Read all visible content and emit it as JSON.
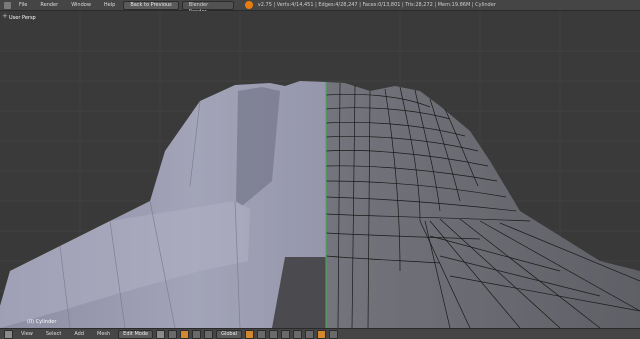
{
  "topbar": {
    "menus": [
      "File",
      "Render",
      "Window",
      "Help"
    ],
    "back_button": "Back to Previous",
    "engine": "Blender Render",
    "stats": "v2.75 | Verts:4/14,451 | Edges:4/28,247 | Faces:0/13,801 | Tris:28,272 | Mem:19.86M | Cylinder"
  },
  "viewport": {
    "view_label": "User Persp",
    "object_label": "(0) Cylinder"
  },
  "bottombar": {
    "menus": [
      "View",
      "Select",
      "Add",
      "Mesh"
    ],
    "mode": "Edit Mode",
    "orientation": "Global"
  },
  "colors": {
    "mesh_left": "#9b9cb2",
    "mesh_right": "#6b6b73",
    "wire": "#151515",
    "symmetry_axis": "#3fb04f",
    "accent": "#e87d0d"
  }
}
